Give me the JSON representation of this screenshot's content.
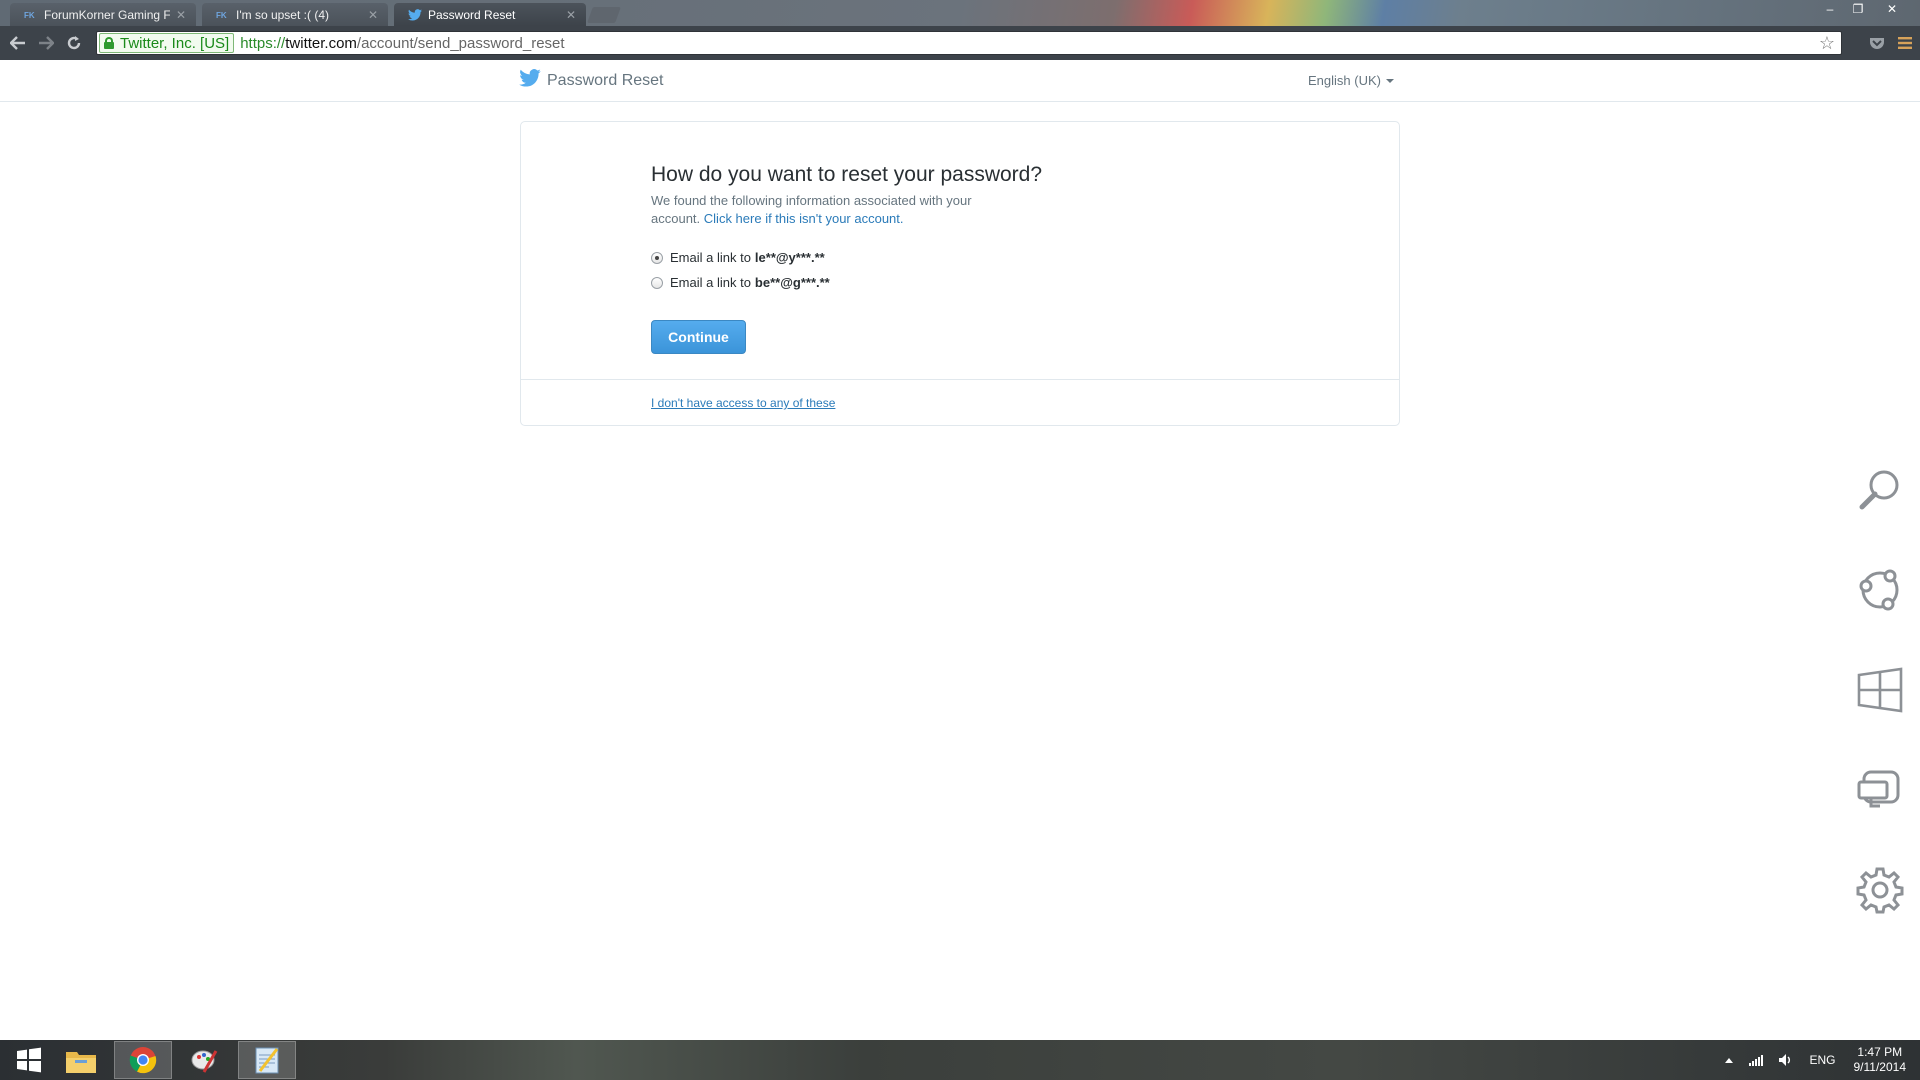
{
  "browser": {
    "tabs": [
      {
        "title": "ForumKorner Gaming For",
        "active": false
      },
      {
        "title": "I'm so upset :( (4)",
        "active": false
      },
      {
        "title": "Password Reset",
        "active": true
      }
    ],
    "ev_cert_label": "Twitter, Inc. [US]",
    "url": {
      "scheme": "https://",
      "host": "twitter.com",
      "path": "/account/send_password_reset"
    },
    "window_controls": [
      "–",
      "❐",
      "✕"
    ]
  },
  "page": {
    "header": {
      "title": "Password Reset",
      "language": "English (UK)"
    },
    "reset": {
      "heading": "How do you want to reset your password?",
      "description": "We found the following information associated with your account.",
      "not_your_account_link": "Click here if this isn't your account.",
      "options": [
        {
          "prefix": "Email a link to",
          "address": "le**@y***.**",
          "checked": true
        },
        {
          "prefix": "Email a link to",
          "address": "be**@g***.**",
          "checked": false
        }
      ],
      "continue_label": "Continue",
      "no_access_link": "I don't have access to any of these"
    },
    "colors": {
      "twitter_blue": "#55acee",
      "link_blue": "#2b7bb9",
      "text_dark": "#292f33",
      "text_muted": "#66757f",
      "border": "#e1e8ed"
    }
  },
  "charms": [
    "search-icon",
    "share-icon",
    "start-icon",
    "devices-icon",
    "settings-icon"
  ],
  "taskbar": {
    "apps": [
      "start-button",
      "file-explorer",
      "chrome",
      "paint-app",
      "notepad-app"
    ],
    "tray": {
      "language": "ENG",
      "time": "1:47 PM",
      "date": "9/11/2014"
    }
  }
}
